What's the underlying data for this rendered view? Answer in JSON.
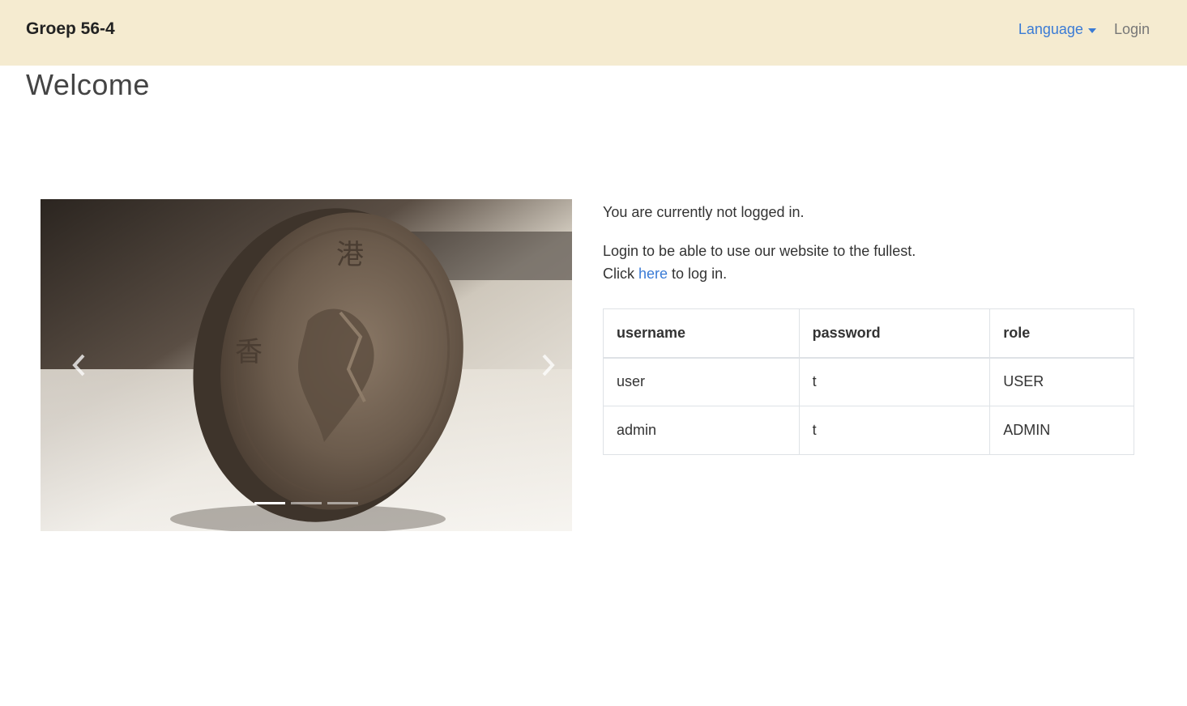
{
  "navbar": {
    "brand": "Groep 56-4",
    "language_label": "Language",
    "login_label": "Login"
  },
  "page": {
    "title": "Welcome"
  },
  "carousel": {
    "slide_count": 3,
    "active_index": 0,
    "prev_icon": "chevron-left-icon",
    "next_icon": "chevron-right-icon"
  },
  "content": {
    "status_text": "You are currently not logged in.",
    "login_prompt": "Login to be able to use our website to the fullest.",
    "click_prefix": "Click ",
    "click_link": "here",
    "click_suffix": " to log in."
  },
  "table": {
    "headers": [
      "username",
      "password",
      "role"
    ],
    "rows": [
      [
        "user",
        "t",
        "USER"
      ],
      [
        "admin",
        "t",
        "ADMIN"
      ]
    ]
  },
  "colors": {
    "navbar_bg": "#f5ebd0",
    "link": "#3a7bd5"
  }
}
